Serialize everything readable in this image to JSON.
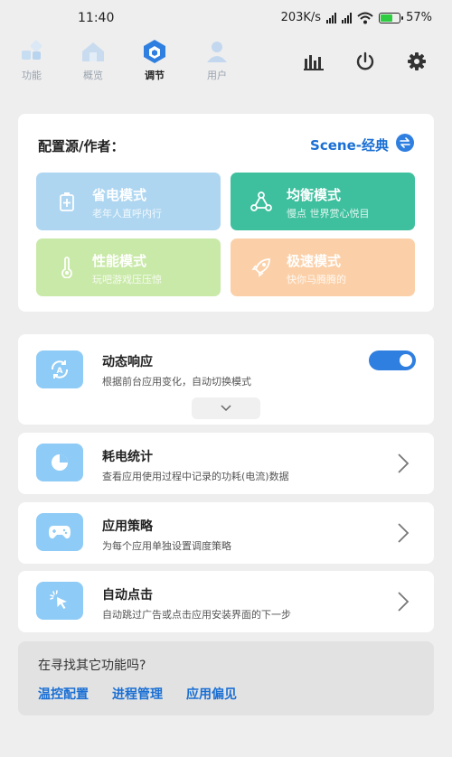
{
  "status": {
    "time": "11:40",
    "net_speed": "203K/s",
    "battery": "57%"
  },
  "nav": {
    "tabs": [
      {
        "label": "功能",
        "icon": "features-icon"
      },
      {
        "label": "概览",
        "icon": "overview-icon"
      },
      {
        "label": "调节",
        "icon": "adjust-icon",
        "active": true
      },
      {
        "label": "用户",
        "icon": "user-icon"
      }
    ],
    "tools": [
      "stats-icon",
      "power-icon",
      "settings-icon"
    ]
  },
  "config": {
    "label": "配置源/作者：",
    "value": "Scene-经典",
    "modes": [
      {
        "title": "省电模式",
        "subtitle": "老年人直呼内行",
        "color": "#aed6f1"
      },
      {
        "title": "均衡模式",
        "subtitle": "慢点 世界赏心悦目",
        "color": "#3ec09e"
      },
      {
        "title": "性能模式",
        "subtitle": "玩吧游戏压压惊",
        "color": "#c9e9a8"
      },
      {
        "title": "极速模式",
        "subtitle": "快你马腾腾的",
        "color": "#fbd0a8"
      }
    ]
  },
  "dynamic": {
    "title": "动态响应",
    "subtitle": "根据前台应用变化，自动切换模式",
    "enabled": true
  },
  "features": [
    {
      "title": "耗电统计",
      "subtitle": "查看应用使用过程中记录的功耗(电流)数据",
      "icon": "pie-chart-icon"
    },
    {
      "title": "应用策略",
      "subtitle": "为每个应用单独设置调度策略",
      "icon": "gamepad-icon"
    },
    {
      "title": "自动点击",
      "subtitle": "自动跳过广告或点击应用安装界面的下一步",
      "icon": "cursor-click-icon"
    }
  ],
  "find_more": {
    "question": "在寻找其它功能吗?",
    "links": [
      "温控配置",
      "进程管理",
      "应用偏见"
    ]
  },
  "colors": {
    "accent": "#2f7fe0",
    "feature_icon_bg": "#8ecbf6"
  }
}
